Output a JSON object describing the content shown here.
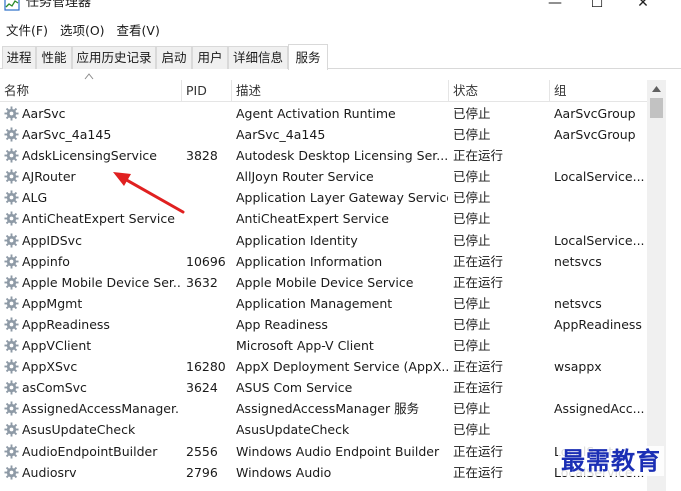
{
  "window": {
    "title": "任务管理器",
    "minimize_glyph": "—",
    "maximize_glyph": "☐",
    "close_glyph": "✕"
  },
  "menu": [
    "文件(F)",
    "选项(O)",
    "查看(V)"
  ],
  "tabs": [
    {
      "label": "进程",
      "active": false
    },
    {
      "label": "性能",
      "active": false
    },
    {
      "label": "应用历史记录",
      "active": false
    },
    {
      "label": "启动",
      "active": false
    },
    {
      "label": "用户",
      "active": false
    },
    {
      "label": "详细信息",
      "active": false
    },
    {
      "label": "服务",
      "active": true
    }
  ],
  "columns": {
    "name": "名称",
    "pid": "PID",
    "desc": "描述",
    "status": "状态",
    "group": "组"
  },
  "rows": [
    {
      "name": "AarSvc",
      "pid": "",
      "desc": "Agent Activation Runtime",
      "status": "已停止",
      "group": "AarSvcGroup"
    },
    {
      "name": "AarSvc_4a145",
      "pid": "",
      "desc": "AarSvc_4a145",
      "status": "已停止",
      "group": "AarSvcGroup"
    },
    {
      "name": "AdskLicensingService",
      "pid": "3828",
      "desc": "Autodesk Desktop Licensing Ser...",
      "status": "正在运行",
      "group": ""
    },
    {
      "name": "AJRouter",
      "pid": "",
      "desc": "AllJoyn Router Service",
      "status": "已停止",
      "group": "LocalService..."
    },
    {
      "name": "ALG",
      "pid": "",
      "desc": "Application Layer Gateway Service",
      "status": "已停止",
      "group": ""
    },
    {
      "name": "AntiCheatExpert Service",
      "pid": "",
      "desc": "AntiCheatExpert Service",
      "status": "已停止",
      "group": ""
    },
    {
      "name": "AppIDSvc",
      "pid": "",
      "desc": "Application Identity",
      "status": "已停止",
      "group": "LocalService..."
    },
    {
      "name": "Appinfo",
      "pid": "10696",
      "desc": "Application Information",
      "status": "正在运行",
      "group": "netsvcs"
    },
    {
      "name": "Apple Mobile Device Ser...",
      "pid": "3632",
      "desc": "Apple Mobile Device Service",
      "status": "正在运行",
      "group": ""
    },
    {
      "name": "AppMgmt",
      "pid": "",
      "desc": "Application Management",
      "status": "已停止",
      "group": "netsvcs"
    },
    {
      "name": "AppReadiness",
      "pid": "",
      "desc": "App Readiness",
      "status": "已停止",
      "group": "AppReadiness"
    },
    {
      "name": "AppVClient",
      "pid": "",
      "desc": "Microsoft App-V Client",
      "status": "已停止",
      "group": ""
    },
    {
      "name": "AppXSvc",
      "pid": "16280",
      "desc": "AppX Deployment Service (AppX...",
      "status": "正在运行",
      "group": "wsappx"
    },
    {
      "name": "asComSvc",
      "pid": "3624",
      "desc": "ASUS Com Service",
      "status": "正在运行",
      "group": ""
    },
    {
      "name": "AssignedAccessManager...",
      "pid": "",
      "desc": "AssignedAccessManager 服务",
      "status": "已停止",
      "group": "AssignedAcc..."
    },
    {
      "name": "AsusUpdateCheck",
      "pid": "",
      "desc": "AsusUpdateCheck",
      "status": "已停止",
      "group": ""
    },
    {
      "name": "AudioEndpointBuilder",
      "pid": "2556",
      "desc": "Windows Audio Endpoint Builder",
      "status": "正在运行",
      "group": "LocalSyste..."
    },
    {
      "name": "Audiosrv",
      "pid": "2796",
      "desc": "Windows Audio",
      "status": "正在运行",
      "group": "LocalService..."
    }
  ],
  "watermark": "最需教育",
  "colors": {
    "annotation_arrow": "#e02020",
    "watermark": "#1b2fb5",
    "tab_border": "#d9d9d9"
  },
  "icons": {
    "row_icon": "gear-icon",
    "app_icon": "task-manager-icon"
  }
}
